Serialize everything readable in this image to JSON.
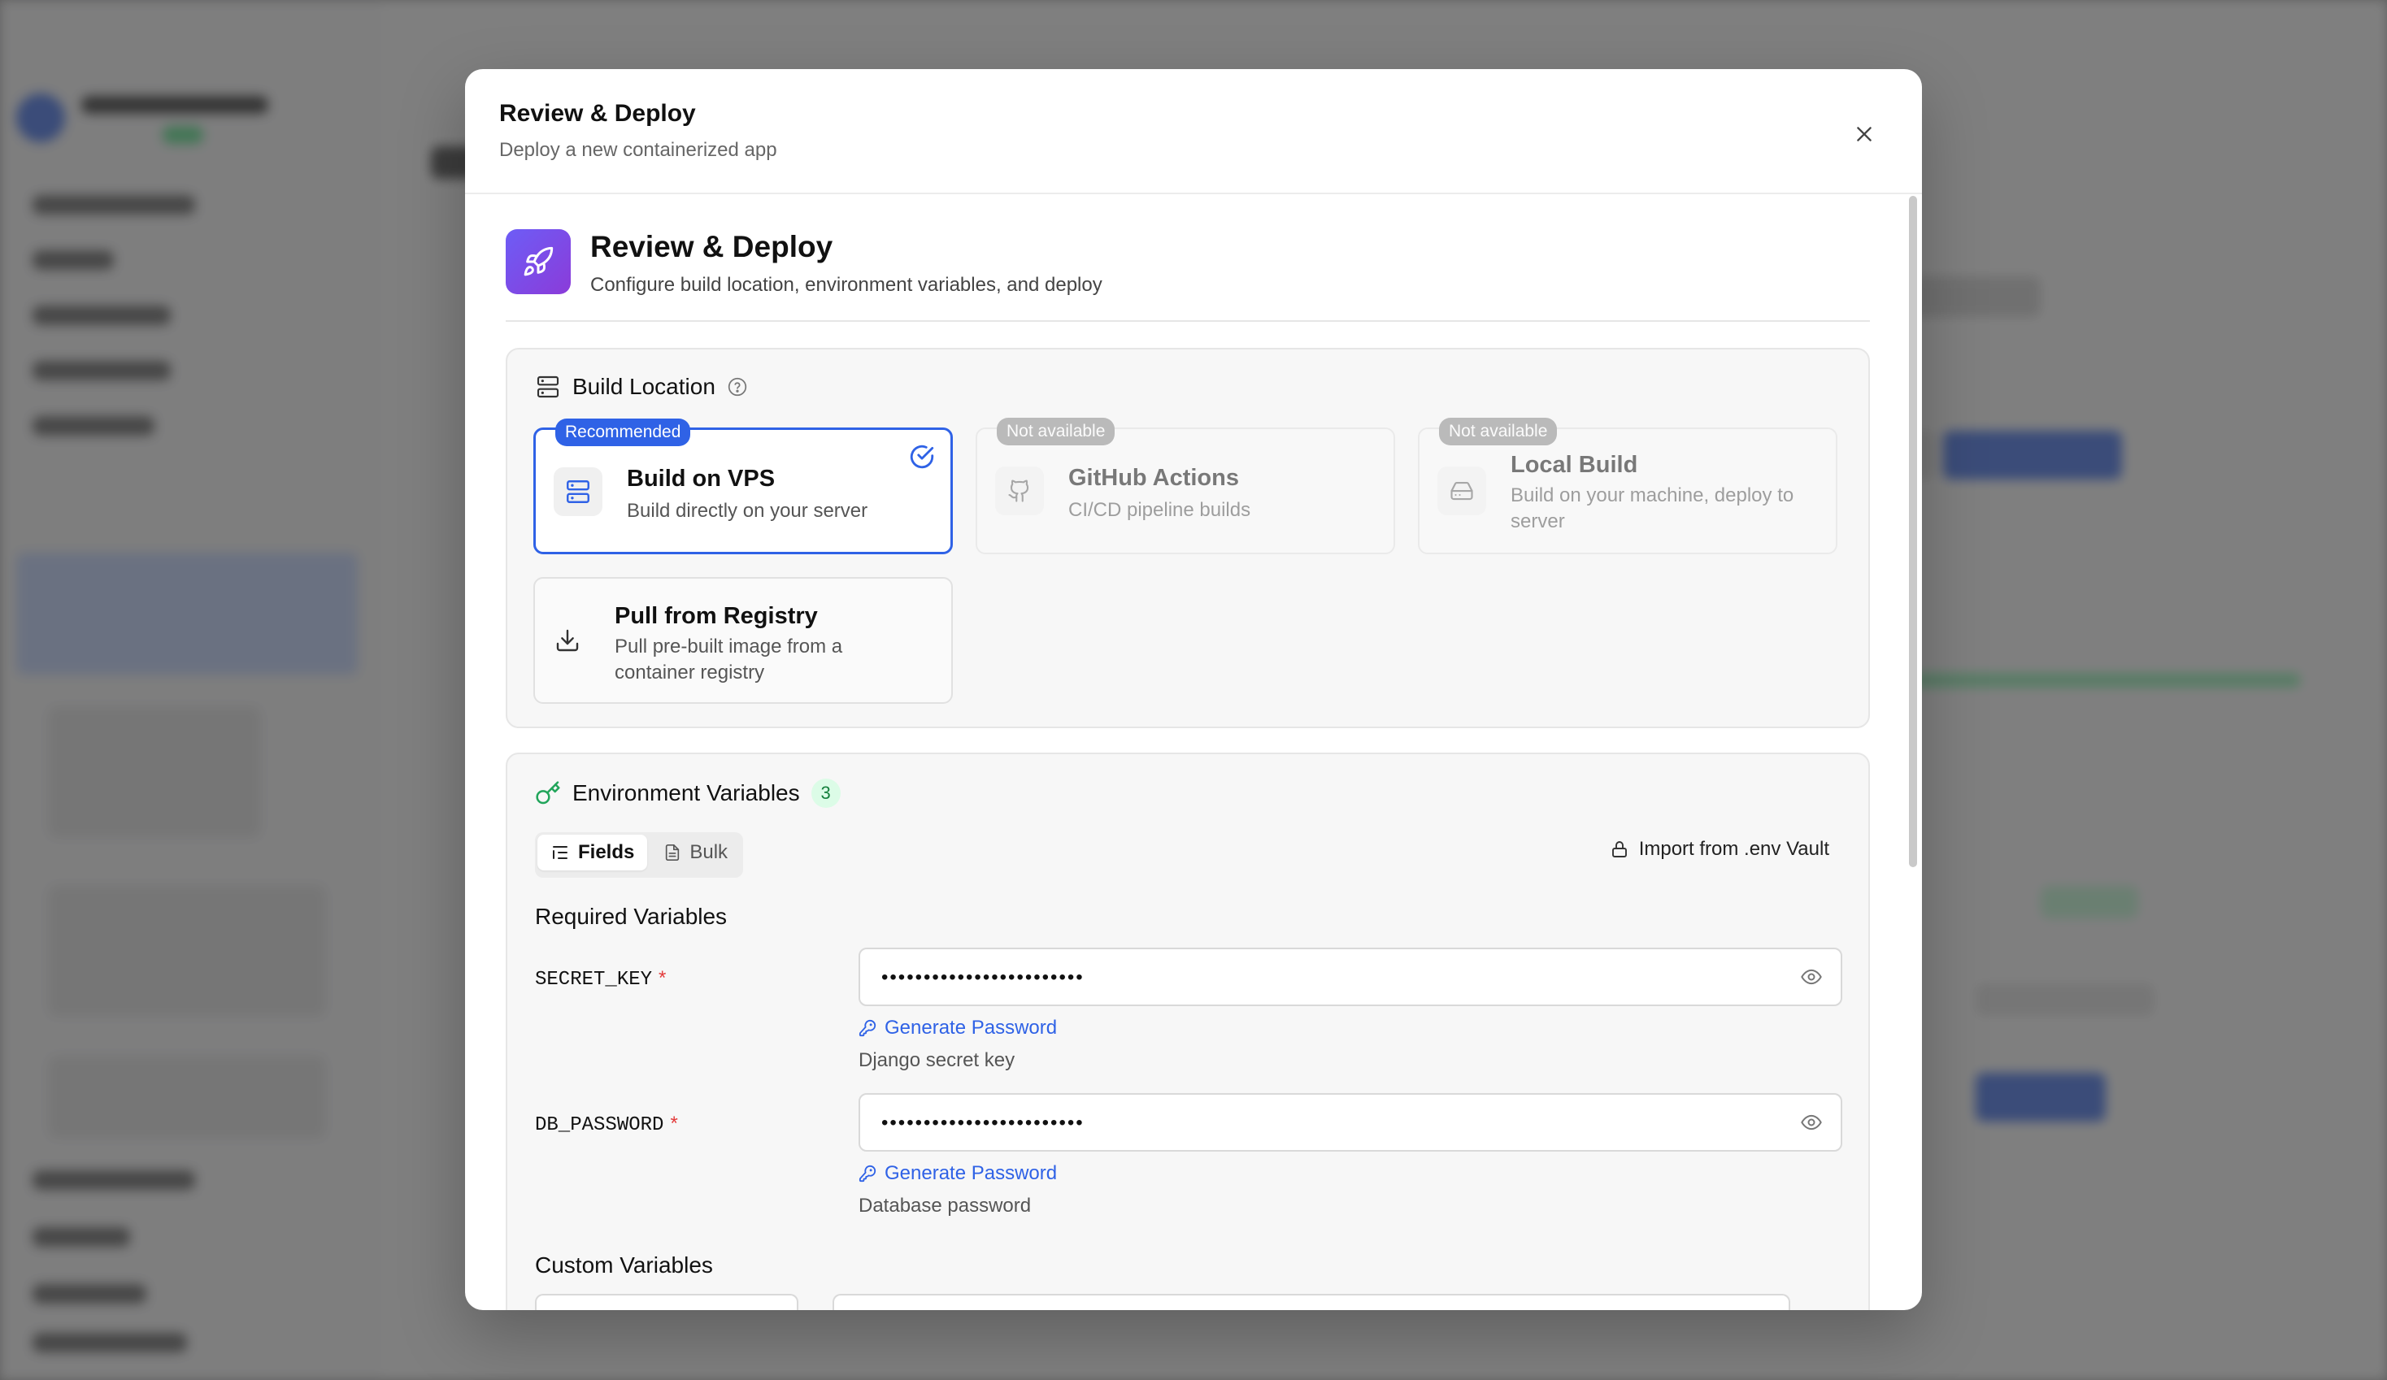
{
  "modal": {
    "title": "Review & Deploy",
    "subtitle": "Deploy a new containerized app"
  },
  "section": {
    "title": "Review & Deploy",
    "subtitle": "Configure build location, environment variables, and deploy"
  },
  "build_location": {
    "title": "Build Location",
    "options": [
      {
        "title": "Build on VPS",
        "desc": "Build directly on your server",
        "badge": "Recommended",
        "selected": true,
        "available": true,
        "icon": "server-icon"
      },
      {
        "title": "GitHub Actions",
        "desc": "CI/CD pipeline builds",
        "badge": "Not available",
        "selected": false,
        "available": false,
        "icon": "github-icon"
      },
      {
        "title": "Local Build",
        "desc": "Build on your machine, deploy to server",
        "badge": "Not available",
        "selected": false,
        "available": false,
        "icon": "hard-drive-icon"
      },
      {
        "title": "Pull from Registry",
        "desc": "Pull pre-built image from a container registry",
        "badge": "",
        "selected": false,
        "available": true,
        "icon": "download-icon"
      }
    ]
  },
  "env_vars": {
    "title": "Environment Variables",
    "count": "3",
    "tabs": {
      "fields": "Fields",
      "bulk": "Bulk"
    },
    "active_tab": "Fields",
    "import_label": "Import from .env Vault",
    "required_label": "Required Variables",
    "required": [
      {
        "key": "SECRET_KEY",
        "value": "••••••••••••••••••••••••",
        "generate_label": "Generate Password",
        "helper": "Django secret key"
      },
      {
        "key": "DB_PASSWORD",
        "value": "••••••••••••••••••••••••",
        "generate_label": "Generate Password",
        "helper": "Database password"
      }
    ],
    "custom_label": "Custom Variables"
  },
  "colors": {
    "accent": "#2f62e6",
    "required_mark": "#e33b3b",
    "count_badge_bg": "#dcfce7",
    "count_badge_fg": "#15803d",
    "rocket_gradient_start": "#6d5df6",
    "rocket_gradient_end": "#8b3bd9"
  }
}
